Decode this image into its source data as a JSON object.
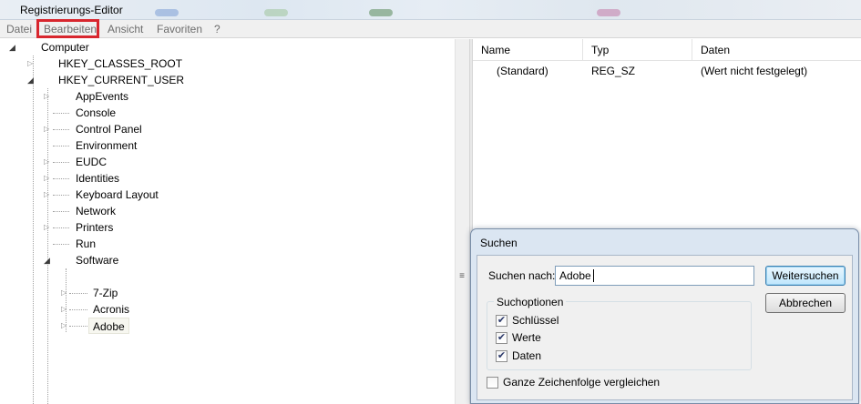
{
  "window": {
    "title": "Registrierungs-Editor"
  },
  "menu": {
    "items": [
      "Datei",
      "Bearbeiten",
      "Ansicht",
      "Favoriten",
      "?"
    ],
    "highlighted": "Bearbeiten",
    "highlight_color": "#d8262e"
  },
  "tree": {
    "root": "Computer",
    "hives": [
      "HKEY_CLASSES_ROOT",
      "HKEY_CURRENT_USER"
    ],
    "current_user_keys": [
      "AppEvents",
      "Console",
      "Control Panel",
      "Environment",
      "EUDC",
      "Identities",
      "Keyboard Layout",
      "Network",
      "Printers",
      "Run",
      "Software"
    ],
    "software_keys": [
      "7-Zip",
      "Acronis",
      "Adobe"
    ],
    "selected": "Adobe"
  },
  "list": {
    "columns": [
      "Name",
      "Typ",
      "Daten"
    ],
    "rows": [
      {
        "name": "(Standard)",
        "type": "REG_SZ",
        "data": "(Wert nicht festgelegt)"
      }
    ]
  },
  "find_dialog": {
    "title": "Suchen",
    "search_label": "Suchen nach:",
    "search_value": "Adobe",
    "find_next": "Weitersuchen",
    "cancel": "Abbrechen",
    "options_title": "Suchoptionen",
    "options": [
      {
        "label": "Schlüssel",
        "checked": true
      },
      {
        "label": "Werte",
        "checked": true
      },
      {
        "label": "Daten",
        "checked": true
      }
    ],
    "match_whole": {
      "label": "Ganze Zeichenfolge vergleichen",
      "checked": false
    }
  }
}
